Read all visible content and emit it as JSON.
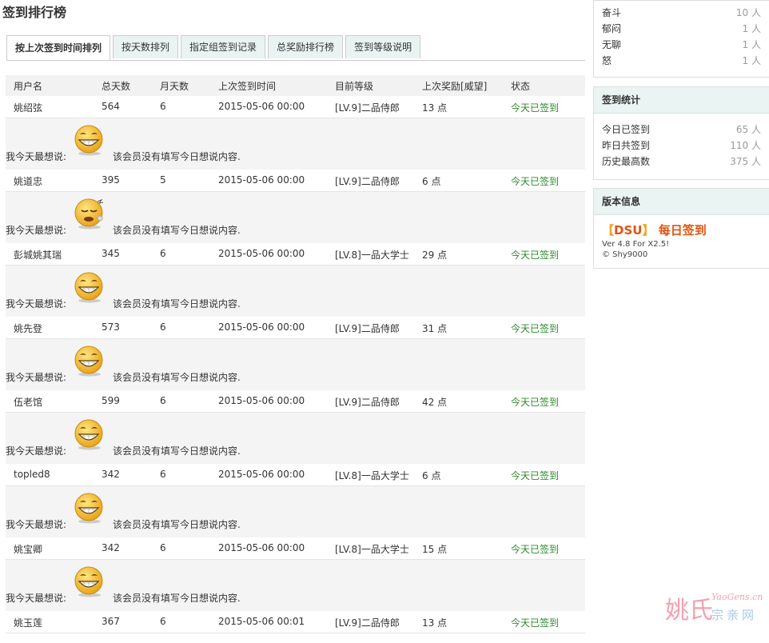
{
  "page_title": "签到排行榜",
  "tabs": [
    {
      "label": "按上次签到时间排列",
      "active": true
    },
    {
      "label": "按天数排列",
      "active": false
    },
    {
      "label": "指定组签到记录",
      "active": false
    },
    {
      "label": "总奖励排行榜",
      "active": false
    },
    {
      "label": "签到等级说明",
      "active": false
    }
  ],
  "table": {
    "headers": [
      "用户名",
      "总天数",
      "月天数",
      "上次签到时间",
      "目前等级",
      "上次奖励[威望]",
      "状态"
    ],
    "msg_label": "我今天最想说:",
    "rows": [
      {
        "user": "姚绍弦",
        "total": "564",
        "month": "6",
        "last": "2015-05-06 00:00",
        "level": "[LV.9]二品侍郎",
        "reward": "13 点",
        "status": "今天已签到",
        "face": "grin",
        "msg": "该会员没有填写今日想说内容."
      },
      {
        "user": "姚道忠",
        "total": "395",
        "month": "5",
        "last": "2015-05-06 00:00",
        "level": "[LV.9]二品侍郎",
        "reward": "6 点",
        "status": "今天已签到",
        "face": "sleepy",
        "msg": "该会员没有填写今日想说内容."
      },
      {
        "user": "彭城姚其瑞",
        "total": "345",
        "month": "6",
        "last": "2015-05-06 00:00",
        "level": "[LV.8]一品大学士",
        "reward": "29 点",
        "status": "今天已签到",
        "face": "grin",
        "msg": "该会员没有填写今日想说内容."
      },
      {
        "user": "姚先登",
        "total": "573",
        "month": "6",
        "last": "2015-05-06 00:00",
        "level": "[LV.9]二品侍郎",
        "reward": "31 点",
        "status": "今天已签到",
        "face": "grin",
        "msg": "该会员没有填写今日想说内容."
      },
      {
        "user": "伍老馆",
        "total": "599",
        "month": "6",
        "last": "2015-05-06 00:00",
        "level": "[LV.9]二品侍郎",
        "reward": "42 点",
        "status": "今天已签到",
        "face": "grin",
        "msg": "该会员没有填写今日想说内容."
      },
      {
        "user": "topled8",
        "total": "342",
        "month": "6",
        "last": "2015-05-06 00:00",
        "level": "[LV.8]一品大学士",
        "reward": "6 点",
        "status": "今天已签到",
        "face": "grin",
        "msg": "该会员没有填写今日想说内容."
      },
      {
        "user": "姚宝卿",
        "total": "342",
        "month": "6",
        "last": "2015-05-06 00:00",
        "level": "[LV.8]一品大学士",
        "reward": "15 点",
        "status": "今天已签到",
        "face": "grin",
        "msg": "该会员没有填写今日想说内容."
      },
      {
        "user": "姚玉莲",
        "total": "367",
        "month": "6",
        "last": "2015-05-06 00:01",
        "level": "[LV.9]二品侍郎",
        "reward": "13 点",
        "status": "今天已签到",
        "face": "grin",
        "msg": ""
      }
    ]
  },
  "mood_stats": [
    {
      "name": "奋斗",
      "value": "10 人"
    },
    {
      "name": "郁闷",
      "value": "1 人"
    },
    {
      "name": "无聊",
      "value": "1 人"
    },
    {
      "name": "怒",
      "value": "1 人"
    }
  ],
  "sign_stats": {
    "title": "签到统计",
    "items": [
      {
        "name": "今日已签到",
        "value": "65 人"
      },
      {
        "name": "昨日共签到",
        "value": "110 人"
      },
      {
        "name": "历史最高数",
        "value": "375 人"
      }
    ]
  },
  "version": {
    "title": "版本信息",
    "bracket_open": "【",
    "brand": "DSU",
    "bracket_close": "】",
    "name": "每日签到",
    "line1": "Ver 4.8 For X2.5!",
    "line2": "© Shy9000"
  },
  "watermark": {
    "main": "姚氏",
    "en": "YaoGens.cn",
    "sub": "宗亲网"
  },
  "colors": {
    "status": "#2d8a2d",
    "brand": "#e0550f",
    "face": "#f5c542"
  }
}
